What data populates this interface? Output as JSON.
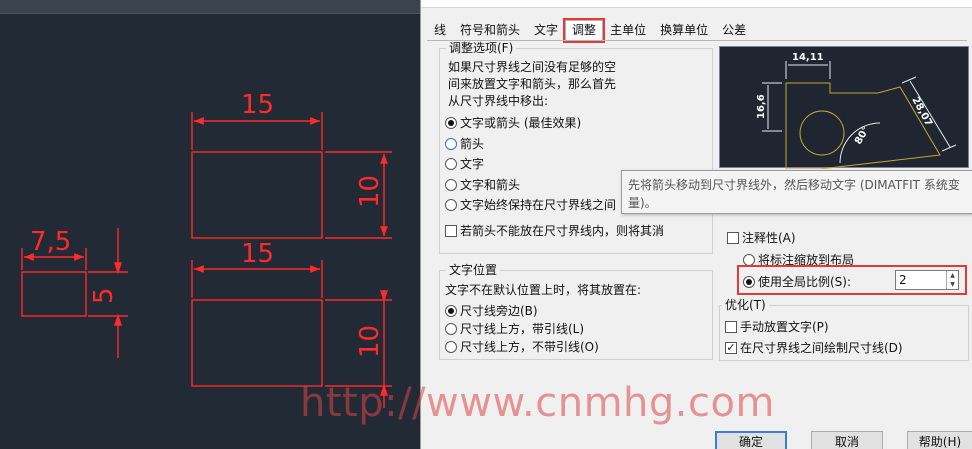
{
  "cad": {
    "dims": {
      "top_width": "15",
      "top_height": "10",
      "mid_width": "15",
      "bottom_height": "10",
      "small_width": "7,5",
      "small_height": "5"
    },
    "colors": {
      "background": "#222a35",
      "dimension": "#ff2a2a"
    }
  },
  "dialog": {
    "tabs": [
      "线",
      "符号和箭头",
      "文字",
      "调整",
      "主单位",
      "换算单位",
      "公差"
    ],
    "active_tab": "调整",
    "fit_options": {
      "title": "调整选项(F)",
      "description": [
        "如果尺寸界线之间没有足够的空",
        "间来放置文字和箭头，那么首先",
        "从尺寸界线中移出:"
      ],
      "options": [
        "文字或箭头 (最佳效果)",
        "箭头",
        "文字",
        "文字和箭头",
        "文字始终保持在尺寸界线之间"
      ],
      "selected": 0,
      "suppress_label": "若箭头不能放在尺寸界线内，则将其消"
    },
    "text_placement": {
      "title": "文字位置",
      "description": "文字不在默认位置上时，将其放置在:",
      "options": [
        "尺寸线旁边(B)",
        "尺寸线上方，带引线(L)",
        "尺寸线上方，不带引线(O)"
      ],
      "selected": 0
    },
    "preview": {
      "dim_top": "14,11",
      "dim_left": "16,6",
      "dim_right": "28,07",
      "dim_angle": "80°"
    },
    "tooltip": "先将箭头移动到尺寸界线外，然后移动文字 (DIMATFIT 系统变量)。",
    "scale": {
      "annotative_label": "注释性(A)",
      "layout_label": "将标注缩放到布局",
      "global_label": "使用全局比例(S):",
      "global_value": "2"
    },
    "finetune": {
      "title": "优化(T)",
      "manual_label": "手动放置文字(P)",
      "draw_line_label": "在尺寸界线之间绘制尺寸线(D)"
    },
    "buttons": {
      "ok": "确定",
      "cancel": "取消",
      "help": "帮助(H)"
    },
    "highlight_color": "#e53935"
  },
  "watermark": "http://www.cnmhg.com"
}
